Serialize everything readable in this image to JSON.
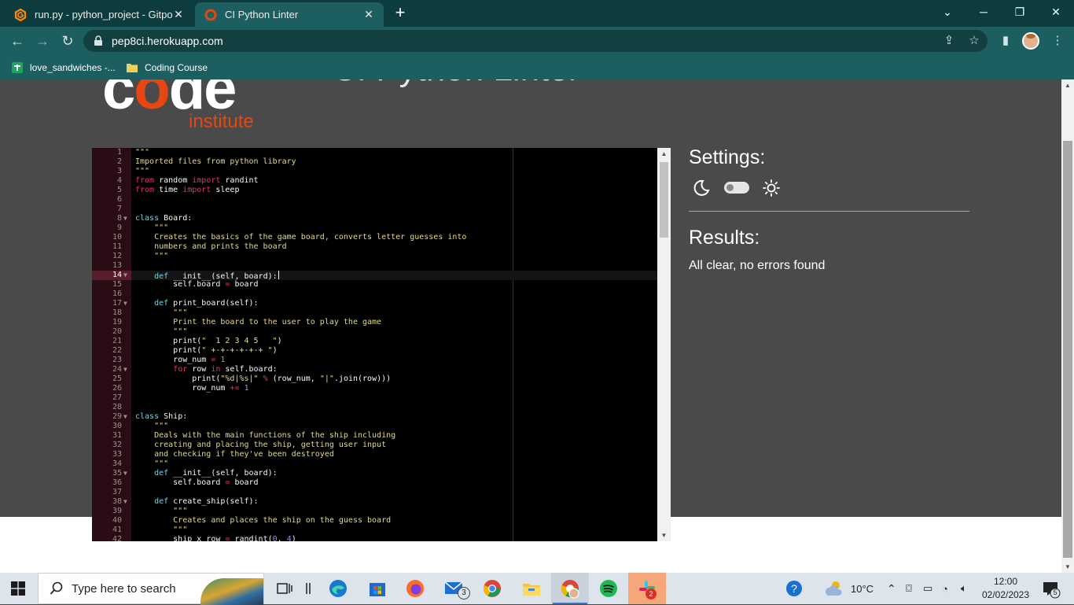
{
  "browser": {
    "tabs": [
      {
        "title": "run.py - python_project - Gitpod",
        "active": false
      },
      {
        "title": "CI Python Linter",
        "active": true
      }
    ],
    "url": "pep8ci.herokuapp.com",
    "bookmarks": [
      {
        "label": "love_sandwiches -..."
      },
      {
        "label": "Coding Course"
      }
    ]
  },
  "page": {
    "logo_word": "code",
    "logo_sub": "institute",
    "heading": "CI Python Linter",
    "settings_title": "Settings:",
    "theme_toggle": {
      "dark_mode": false
    },
    "results_title": "Results:",
    "results_message": "All clear, no errors found"
  },
  "editor": {
    "cursor_line": 14,
    "lines": [
      {
        "n": "1",
        "text": "\"\"\""
      },
      {
        "n": "2",
        "text": "Imported files from python library"
      },
      {
        "n": "3",
        "text": "\"\"\""
      },
      {
        "n": "4",
        "text": "from random import randint"
      },
      {
        "n": "5",
        "text": "from time import sleep"
      },
      {
        "n": "6",
        "text": ""
      },
      {
        "n": "7",
        "text": ""
      },
      {
        "n": "8",
        "text": "class Board:",
        "fold": true
      },
      {
        "n": "9",
        "text": "    \"\"\""
      },
      {
        "n": "10",
        "text": "    Creates the basics of the game board, converts letter guesses into"
      },
      {
        "n": "11",
        "text": "    numbers and prints the board"
      },
      {
        "n": "12",
        "text": "    \"\"\""
      },
      {
        "n": "13",
        "text": ""
      },
      {
        "n": "14",
        "text": "    def __init__(self, board):",
        "fold": true
      },
      {
        "n": "15",
        "text": "        self.board = board"
      },
      {
        "n": "16",
        "text": ""
      },
      {
        "n": "17",
        "text": "    def print_board(self):",
        "fold": true
      },
      {
        "n": "18",
        "text": "        \"\"\""
      },
      {
        "n": "19",
        "text": "        Print the board to the user to play the game"
      },
      {
        "n": "20",
        "text": "        \"\"\""
      },
      {
        "n": "21",
        "text": "        print(\"  1 2 3 4 5   \")"
      },
      {
        "n": "22",
        "text": "        print(\" +-+-+-+-+-+ \")"
      },
      {
        "n": "23",
        "text": "        row_num = 1"
      },
      {
        "n": "24",
        "text": "        for row in self.board:",
        "fold": true
      },
      {
        "n": "25",
        "text": "            print(\"%d|%s|\" % (row_num, \"|\".join(row)))"
      },
      {
        "n": "26",
        "text": "            row_num += 1"
      },
      {
        "n": "27",
        "text": ""
      },
      {
        "n": "28",
        "text": ""
      },
      {
        "n": "29",
        "text": "class Ship:",
        "fold": true
      },
      {
        "n": "30",
        "text": "    \"\"\""
      },
      {
        "n": "31",
        "text": "    Deals with the main functions of the ship including"
      },
      {
        "n": "32",
        "text": "    creating and placing the ship, getting user input"
      },
      {
        "n": "33",
        "text": "    and checking if they've been destroyed"
      },
      {
        "n": "34",
        "text": "    \"\"\""
      },
      {
        "n": "35",
        "text": "    def __init__(self, board):",
        "fold": true
      },
      {
        "n": "36",
        "text": "        self.board = board"
      },
      {
        "n": "37",
        "text": ""
      },
      {
        "n": "38",
        "text": "    def create_ship(self):",
        "fold": true
      },
      {
        "n": "39",
        "text": "        \"\"\""
      },
      {
        "n": "40",
        "text": "        Creates and places the ship on the guess board"
      },
      {
        "n": "41",
        "text": "        \"\"\""
      },
      {
        "n": "42",
        "text": "        ship_x_row = randint(0, 4)"
      }
    ]
  },
  "taskbar": {
    "search_placeholder": "Type here to search",
    "weather": "10°C",
    "time": "12:00",
    "date": "02/02/2023",
    "mail_badge": "3",
    "slack_badge": "2",
    "notifications_badge": "5"
  }
}
